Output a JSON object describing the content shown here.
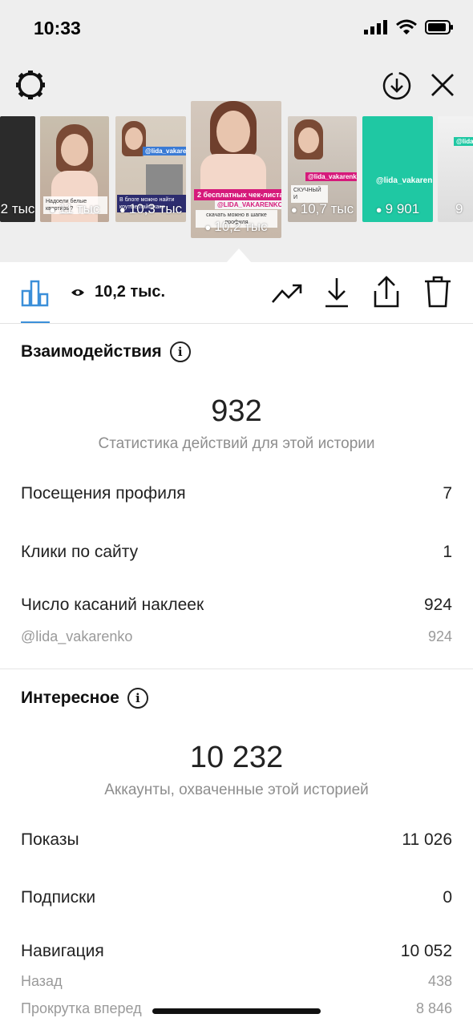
{
  "status_bar": {
    "time": "10:33"
  },
  "stories": [
    {
      "views": "2 тыс",
      "caption": ""
    },
    {
      "views": "11 тыс",
      "caption": "Надоели белые квартиры?"
    },
    {
      "views": "10,3 тыс",
      "handle": "@lida_vakarenko",
      "caption": "В блоге можно найти крутые лайфхаки"
    },
    {
      "views": "10,2 тыс",
      "pink": "2 бесплатных чек-листа",
      "caption": "скачать можно в шапке профиля",
      "handle": "@LIDA_VAKARENKO"
    },
    {
      "views": "10,7 тыс",
      "handle": "@lida_vakarenko",
      "caption": "СКУЧНЫЙ И"
    },
    {
      "views": "9 901",
      "handle": "@lida_vakarenko"
    },
    {
      "views": "9",
      "handle": "@lida_va"
    }
  ],
  "toolbar": {
    "views": "10,2 тыс."
  },
  "interactions": {
    "title": "Взаимодействия",
    "total": "932",
    "subtitle": "Статистика действий для этой истории",
    "rows": [
      {
        "label": "Посещения профиля",
        "value": "7"
      },
      {
        "label": "Клики по сайту",
        "value": "1"
      },
      {
        "label": "Число касаний наклеек",
        "value": "924"
      }
    ],
    "sub_rows": [
      {
        "label": "@lida_vakarenko",
        "value": "924"
      }
    ]
  },
  "discovery": {
    "title": "Интересное",
    "total": "10 232",
    "subtitle": "Аккаунты, охваченные этой историей",
    "rows": [
      {
        "label": "Показы",
        "value": "11 026"
      },
      {
        "label": "Подписки",
        "value": "0"
      },
      {
        "label": "Навигация",
        "value": "10 052"
      }
    ],
    "sub_rows": [
      {
        "label": "Назад",
        "value": "438"
      },
      {
        "label": "Прокрутка вперед",
        "value": "8 846"
      }
    ]
  },
  "colors": {
    "accent": "#3b8fd9",
    "sticker_pink": "#d61a7b",
    "teal": "#1fc8a3"
  },
  "icons": [
    "gear-icon",
    "download-circle-icon",
    "close-icon",
    "bar-chart-icon",
    "eye-icon",
    "trend-icon",
    "download-icon",
    "share-icon",
    "trash-icon",
    "info-icon"
  ]
}
